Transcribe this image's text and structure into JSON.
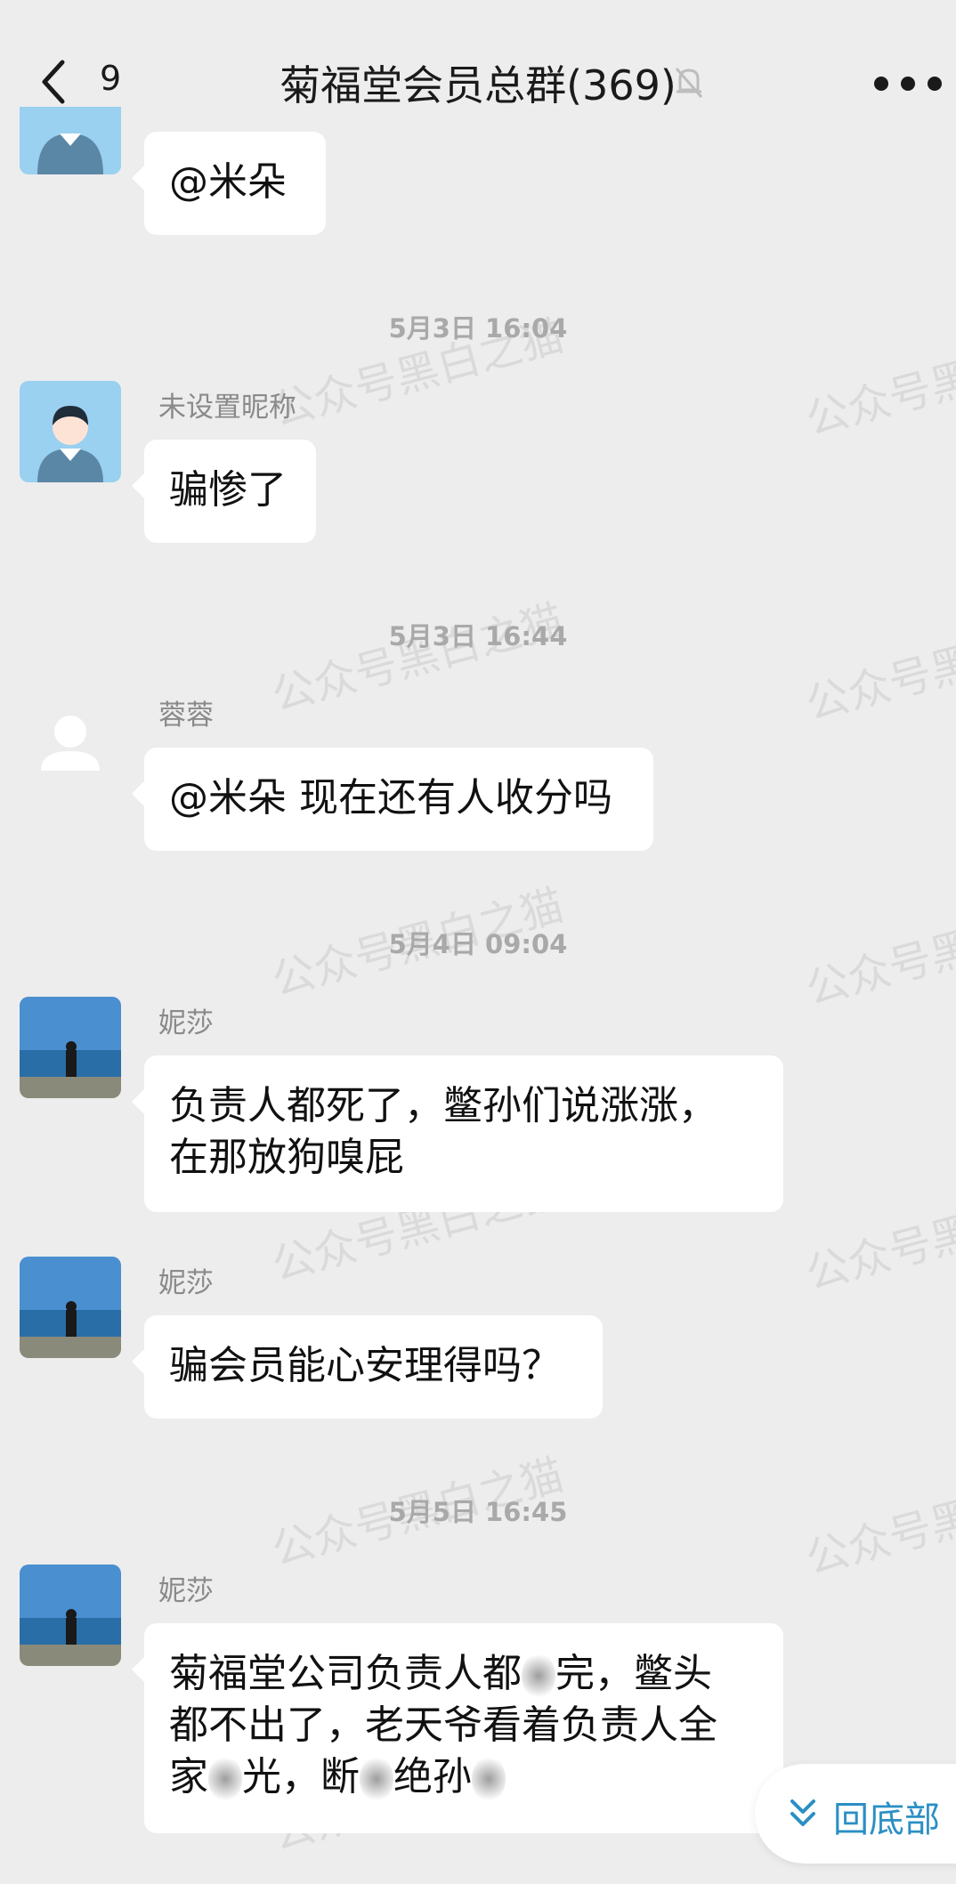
{
  "header": {
    "back_count": "9",
    "title": "菊福堂会员总群(369)",
    "back_icon": "chevron-left-icon",
    "mute_icon": "bell-off-icon",
    "more_icon": "more-horizontal-icon"
  },
  "watermark": "公众号黑白之猫",
  "messages": [
    {
      "text_lines": [
        "@米朵"
      ]
    },
    {
      "time": "5月3日 16:04"
    },
    {
      "sender": "未设置昵称",
      "avatar": "default-person-avatar",
      "text_lines": [
        "骗惨了"
      ]
    },
    {
      "time": "5月3日 16:44"
    },
    {
      "sender": "蓉蓉",
      "avatar": "blank-person-avatar",
      "text_lines": [
        "@米朵 现在还有人收分吗"
      ]
    },
    {
      "time": "5月4日 09:04"
    },
    {
      "sender": "妮莎",
      "avatar": "sea-photo-avatar",
      "text_lines": [
        "负责人都死了，鳖孙们说涨涨，",
        "在那放狗嗅屁"
      ]
    },
    {
      "sender": "妮莎",
      "avatar": "sea-photo-avatar",
      "text_lines": [
        "骗会员能心安理得吗？"
      ]
    },
    {
      "time": "5月5日 16:45"
    },
    {
      "sender": "妮莎",
      "avatar": "sea-photo-avatar",
      "text_lines": [
        "菊福堂公司负责人都",
        "完，鳖头",
        "都不出了，老天爷看着负责人全",
        "家",
        "光，断",
        "绝孙"
      ]
    }
  ],
  "scroll_bottom": {
    "label": "回底部",
    "icon": "double-chevron-down-icon"
  },
  "colors": {
    "background": "#ededed",
    "bubble": "#ffffff",
    "link": "#2b8fc4"
  }
}
